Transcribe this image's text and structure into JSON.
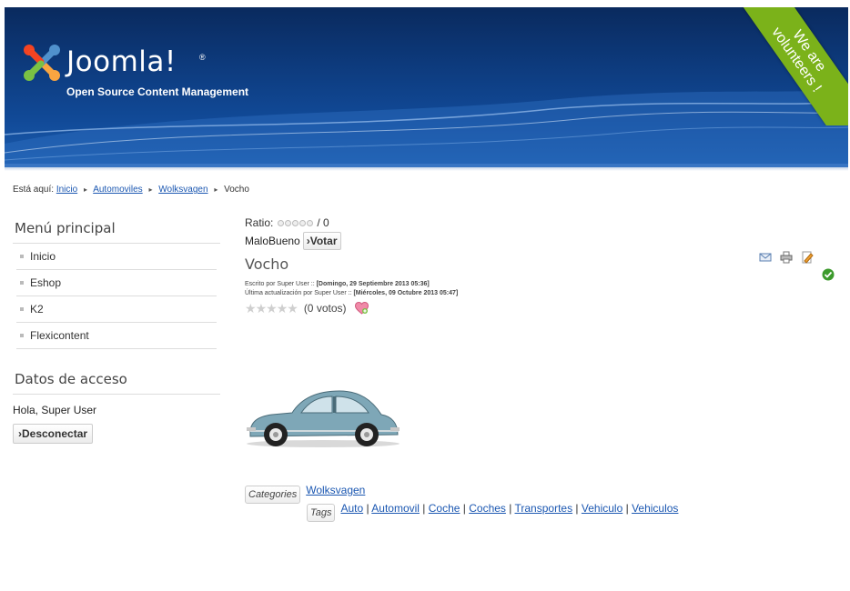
{
  "header": {
    "logo_text": "Joomla!",
    "logo_registered": "®",
    "tagline": "Open Source Content Management",
    "ribbon_line1": "We are",
    "ribbon_line2": "volunteers !"
  },
  "breadcrumb": {
    "prefix": "Está aquí:",
    "items": [
      "Inicio",
      "Automoviles",
      "Wolksvagen"
    ],
    "current": "Vocho"
  },
  "sidebar": {
    "menu_title": "Menú principal",
    "menu_items": [
      "Inicio",
      "Eshop",
      "K2",
      "Flexicontent"
    ],
    "login_title": "Datos de acceso",
    "greeting": "Hola, Super User",
    "logout_label": "›Desconectar"
  },
  "article": {
    "ratio_label": "Ratio:",
    "ratio_value": "/ 0",
    "vote_options": "MaloBueno",
    "vote_button": "›Votar",
    "title": "Vocho",
    "written_label": "Escrito por Super User ::",
    "written_date": "[Domingo, 29 Septiembre 2013 05:36]",
    "updated_label": "Última actualización por Super User ::",
    "updated_date": "[Miércoles, 09 Octubre 2013 05:47]",
    "votes_text": "(0 votos)",
    "categories_label": "Categories",
    "category": "Wolksvagen",
    "tags_label": "Tags",
    "tags": [
      "Auto",
      "Automovil",
      "Coche",
      "Coches",
      "Transportes",
      "Vehiculo",
      "Vehiculos"
    ]
  },
  "colors": {
    "header_dark": "#0a2a5e",
    "ribbon_green": "#7bb21a",
    "link_blue": "#1b57b1"
  },
  "icons": {
    "email": "email-icon",
    "print": "print-icon",
    "edit": "edit-icon",
    "published": "check-icon",
    "favorite": "heart-icon"
  }
}
